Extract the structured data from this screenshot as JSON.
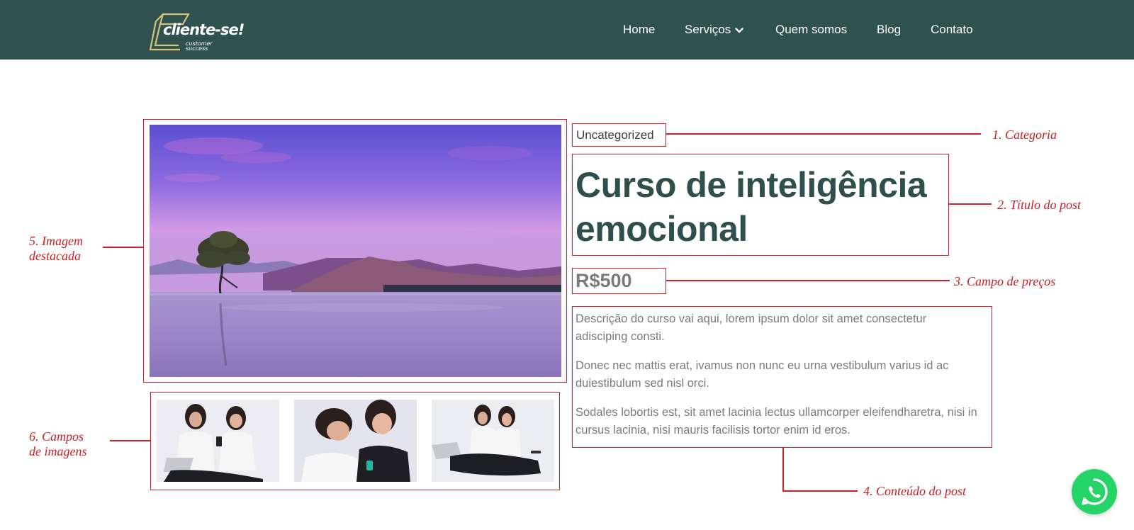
{
  "brand": {
    "name": "cliente-se!",
    "tagline": "customer success",
    "colors": {
      "header_bg": "#2f5250",
      "title": "#2f4f4e",
      "annotation": "#d32026",
      "whatsapp": "#25d366",
      "logo_gold": "#d8c27a"
    }
  },
  "nav": {
    "items": [
      {
        "label": "Home"
      },
      {
        "label": "Serviços",
        "has_dropdown": true
      },
      {
        "label": "Quem somos"
      },
      {
        "label": "Blog"
      },
      {
        "label": "Contato"
      }
    ]
  },
  "post": {
    "category": "Uncategorized",
    "title": "Curso de inteligência emocional",
    "price": "R$500",
    "paragraphs": [
      "Descrição do curso vai aqui, lorem ipsum dolor sit amet consectetur adisciping consti.",
      "Donec nec mattis erat, ivamus non nunc eu urna vestibulum varius id ac duiestibulum sed nisl orci.",
      "Sodales lobortis est, sit amet lacinia lectus ullamcorper eleifendharetra, nisi in cursus lacinia, nisi mauris facilisis tortor enim id eros."
    ]
  },
  "annotations": {
    "category": "1. Categoria",
    "title": "2. Título do post",
    "price": "3. Campo de preços",
    "content": "4. Conteúdo do post",
    "featured_line1": "5. Imagem",
    "featured_line2": "destacada",
    "gallery_line1": "6. Campos",
    "gallery_line2": "de imagens"
  },
  "icons": {
    "dropdown": "chevron-down-icon",
    "whatsapp": "whatsapp-icon"
  }
}
